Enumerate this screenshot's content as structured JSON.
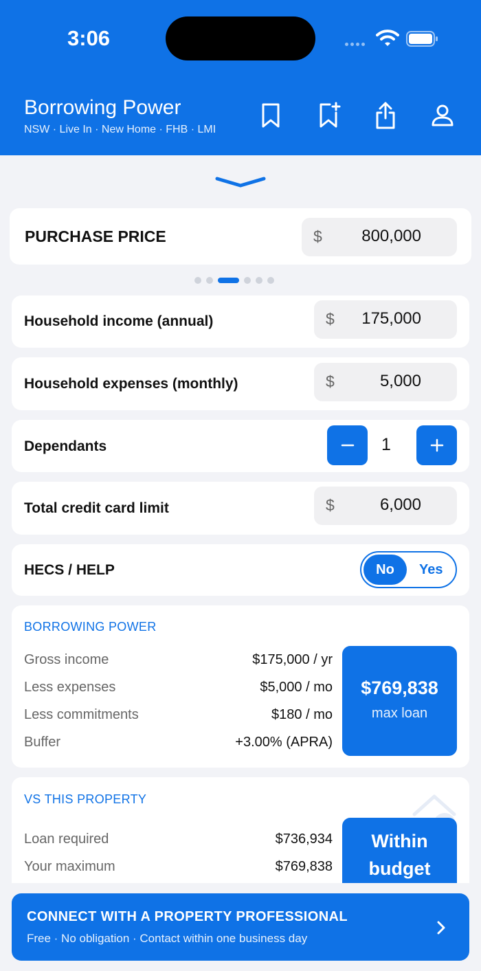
{
  "status_bar": {
    "time": "3:06"
  },
  "header": {
    "title": "Borrowing Power",
    "subtitle": "NSW · Live In · New Home · FHB · LMI",
    "icons": [
      "bookmark-icon",
      "bookmark-add-icon",
      "share-icon",
      "profile-icon"
    ]
  },
  "purchase": {
    "label": "PURCHASE PRICE",
    "currency": "$",
    "value": "800,000"
  },
  "pager": {
    "count": 6,
    "active": 2
  },
  "fields": {
    "income": {
      "label": "Household income (annual)",
      "currency": "$",
      "value": "175,000"
    },
    "expenses": {
      "label": "Household expenses (monthly)",
      "currency": "$",
      "value": "5,000"
    },
    "dependants": {
      "label": "Dependants",
      "value": "1"
    },
    "credit": {
      "label": "Total credit card limit",
      "currency": "$",
      "value": "6,000"
    },
    "hecs": {
      "label": "HECS / HELP",
      "no": "No",
      "yes": "Yes",
      "selected": "No"
    }
  },
  "borrowing": {
    "title": "BORROWING POWER",
    "rows": [
      {
        "label": "Gross income",
        "value": "$175,000 / yr"
      },
      {
        "label": "Less expenses",
        "value": "$5,000 / mo"
      },
      {
        "label": "Less commitments",
        "value": "$180 / mo"
      },
      {
        "label": "Buffer",
        "value": "+3.00% (APRA)"
      }
    ],
    "result_value": "$769,838",
    "result_caption": "max loan"
  },
  "property": {
    "title": "VS THIS PROPERTY",
    "rows": [
      {
        "label": "Loan required",
        "value": "$736,934"
      },
      {
        "label": "Your maximum",
        "value": "$769,838"
      }
    ],
    "result_line1": "Within",
    "result_line2": "budget"
  },
  "cta": {
    "heading": "CONNECT WITH A PROPERTY PROFESSIONAL",
    "sub": "Free · No obligation · Contact within one business day"
  },
  "colors": {
    "brand": "#0f72e6",
    "background": "#f2f3f7",
    "field": "#f0f0f2"
  }
}
